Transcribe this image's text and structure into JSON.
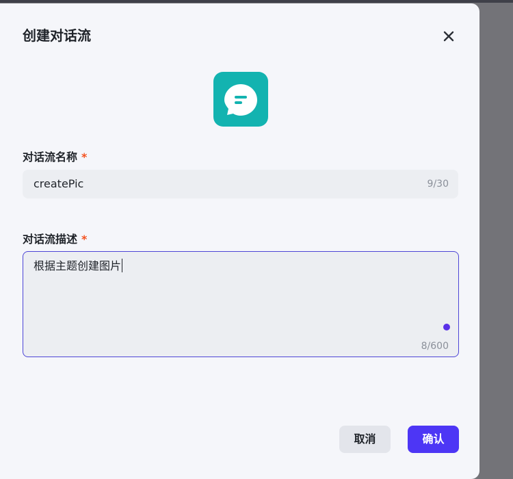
{
  "dialog": {
    "title": "创建对话流",
    "close_icon": "close-icon",
    "app_icon": "chat-bubble-icon",
    "colors": {
      "app_icon_bg": "#13b3b0",
      "primary": "#4d36f5",
      "required": "#f4511e"
    }
  },
  "name_field": {
    "label": "对话流名称",
    "required_mark": "*",
    "value": "createPic",
    "counter": "9/30"
  },
  "desc_field": {
    "label": "对话流描述",
    "required_mark": "*",
    "value": "根据主题创建图片",
    "counter": "8/600"
  },
  "buttons": {
    "cancel": "取消",
    "confirm": "确认"
  }
}
